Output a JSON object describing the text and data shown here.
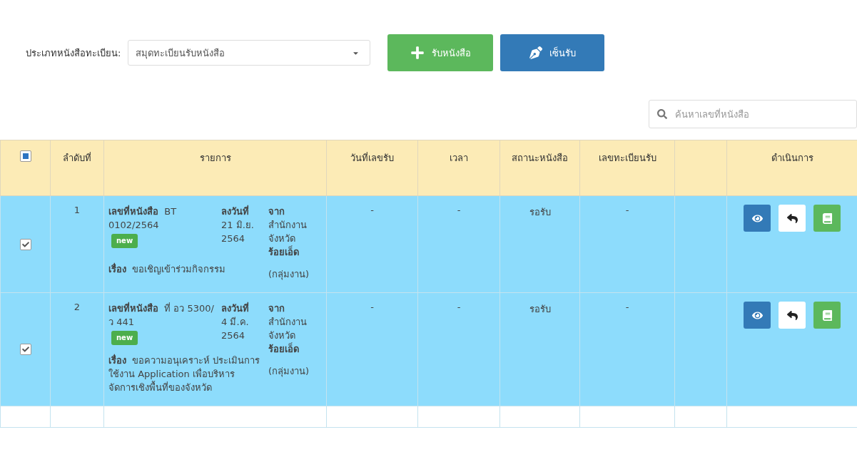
{
  "filter": {
    "label": "ประเภทหนังสือทะเบียน:",
    "value": "สมุดทะเบียนรับหนังสือ"
  },
  "buttons": [
    {
      "kind": "receive",
      "label": "รับหนังสือ"
    },
    {
      "kind": "sign",
      "label": "เซ็นรับ"
    }
  ],
  "search": {
    "placeholder": "ค้นหาเลขที่หนังสือ"
  },
  "table": {
    "select_all": {
      "indeterminate": true
    },
    "columns": [
      "ลำดับที่",
      "รายการ",
      "วันที่เลขรับ",
      "เวลา",
      "สถานะหนังสือ",
      "เลขทะเบียนรับ",
      "ดำเนินการ"
    ],
    "rows": [
      {
        "checked": true,
        "index": "1",
        "doc_label": "เลขที่หนังสือ",
        "doc_no": "BT 0102/2564",
        "badge": "new",
        "date_label": "ลงวันที่",
        "date": "21 มิ.ย. 2564",
        "from_label": "จาก",
        "from": "สำนักงาน จังหวัด **ร้อยเอ็ด**",
        "group": "(กลุ่มงาน)",
        "subject_label": "เรื่อง",
        "subject": "ขอเชิญเข้าร่วมกิจกรรม",
        "received_date": "-",
        "time": "-",
        "status": "รอรับ",
        "reg_no": "-"
      },
      {
        "checked": true,
        "index": "2",
        "doc_label": "เลขที่หนังสือ",
        "doc_no": "ที่ อว 5300/ว 441",
        "badge": "new",
        "date_label": "ลงวันที่",
        "date": "4 มี.ค. 2564",
        "from_label": "จาก",
        "from": "สำนักงาน จังหวัด **ร้อยเอ็ด**",
        "group": "(กลุ่มงาน)",
        "subject_label": "เรื่อง",
        "subject": "ขอความอนุเคราะห์ ประเมินการใช้งาน Application เพื่อบริหาร จัดการเชิงพื้นที่ของจังหวัด",
        "received_date": "-",
        "time": "-",
        "status": "รอรับ",
        "reg_no": "-"
      }
    ]
  }
}
